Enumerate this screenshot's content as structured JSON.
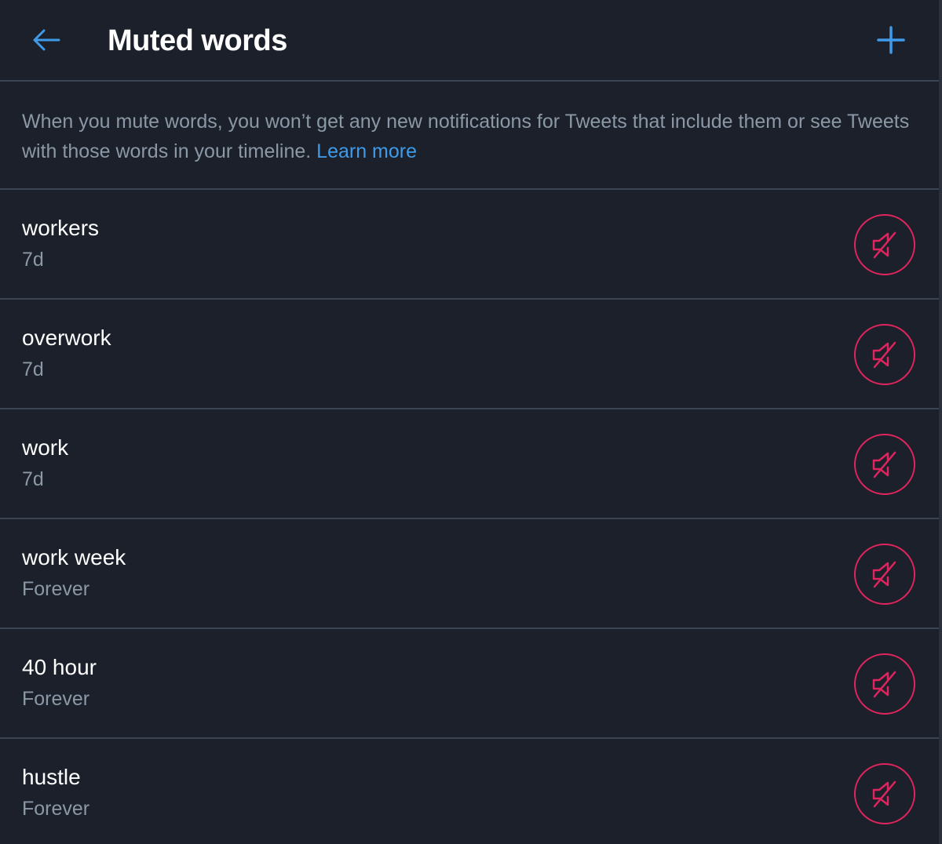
{
  "header": {
    "title": "Muted words",
    "back_icon": "arrow-left-icon",
    "add_icon": "plus-icon"
  },
  "info": {
    "text": "When you mute words, you won’t get any new notifications for Tweets that include them or see Tweets with those words in your timeline.",
    "link": "Learn more"
  },
  "muted_words": [
    {
      "word": "workers",
      "duration": "7d"
    },
    {
      "word": "overwork",
      "duration": "7d"
    },
    {
      "word": "work",
      "duration": "7d"
    },
    {
      "word": "work week",
      "duration": "Forever"
    },
    {
      "word": "40 hour",
      "duration": "Forever"
    },
    {
      "word": "hustle",
      "duration": "Forever"
    }
  ],
  "colors": {
    "background": "#1b202b",
    "accent": "#3f9be9",
    "unmute": "#e0245e",
    "secondary_text": "#8b98a5"
  }
}
